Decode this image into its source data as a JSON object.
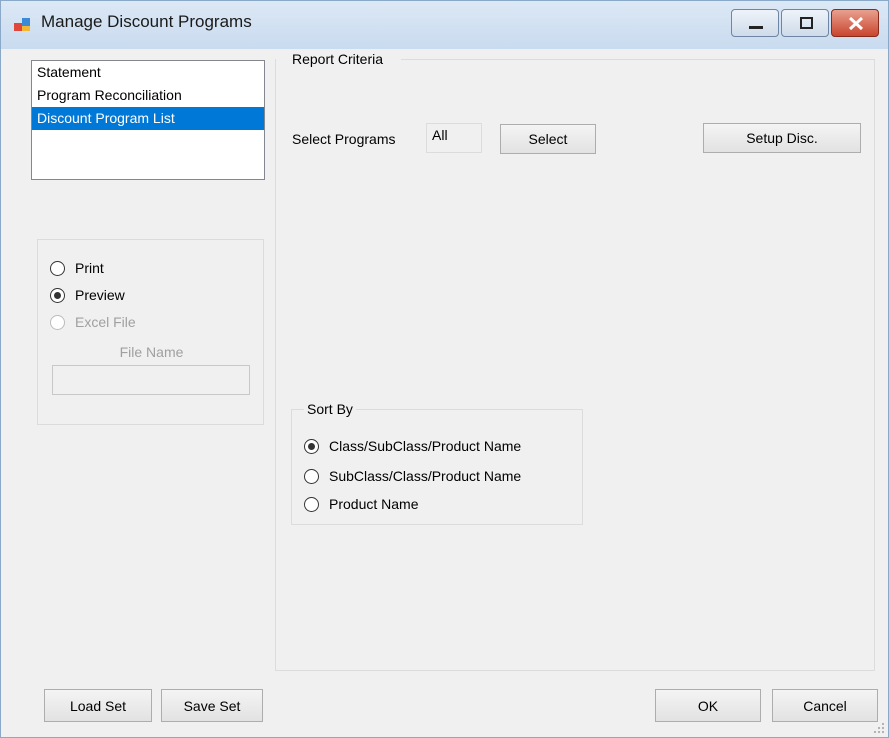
{
  "window": {
    "title": "Manage Discount Programs"
  },
  "report_list": {
    "items": [
      {
        "label": "Statement",
        "selected": false
      },
      {
        "label": "Program Reconciliation",
        "selected": false
      },
      {
        "label": "Discount Program List",
        "selected": true
      }
    ]
  },
  "output": {
    "options": [
      {
        "label": "Print",
        "checked": false,
        "enabled": true
      },
      {
        "label": "Preview",
        "checked": true,
        "enabled": true
      },
      {
        "label": "Excel File",
        "checked": false,
        "enabled": false
      }
    ],
    "file_name_label": "File Name",
    "file_name_value": ""
  },
  "criteria": {
    "legend": "Report Criteria",
    "select_programs_label": "Select Programs",
    "select_programs_value": "All",
    "select_button": "Select",
    "setup_button": "Setup Disc."
  },
  "sort": {
    "legend": "Sort By",
    "options": [
      {
        "label": "Class/SubClass/Product Name",
        "checked": true
      },
      {
        "label": "SubClass/Class/Product Name",
        "checked": false
      },
      {
        "label": "Product Name",
        "checked": false
      }
    ]
  },
  "footer": {
    "load_set": "Load Set",
    "save_set": "Save Set",
    "ok": "OK",
    "cancel": "Cancel"
  },
  "colors": {
    "selection": "#0078d7",
    "close_button": "#c9452e"
  }
}
